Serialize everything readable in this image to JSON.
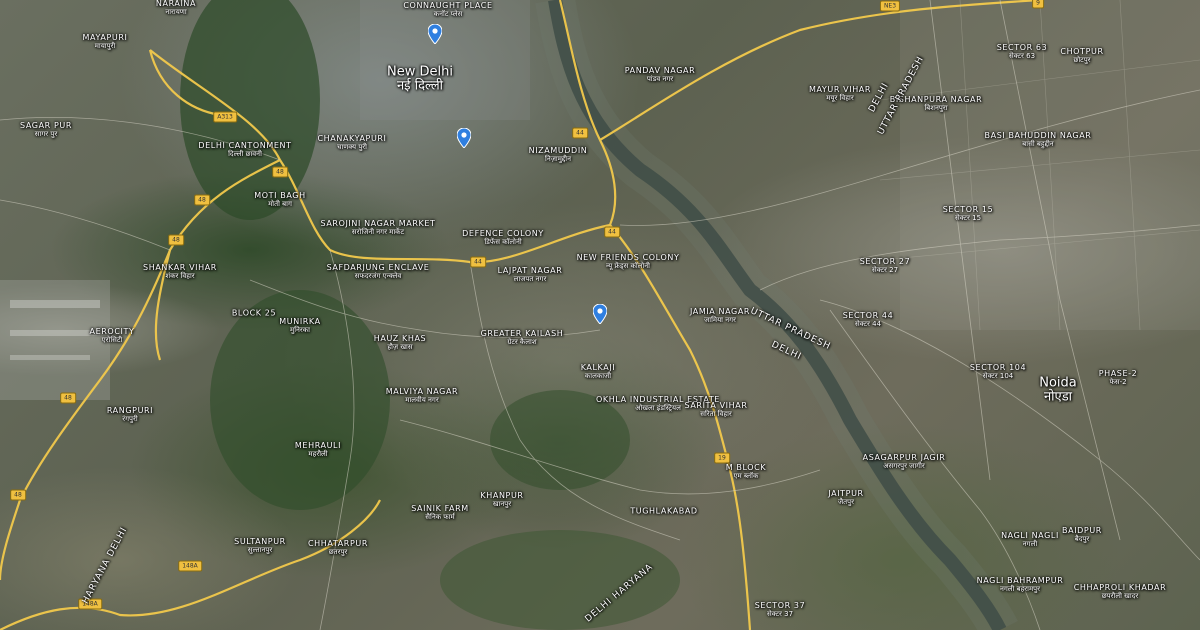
{
  "map": {
    "colors": {
      "road_major": "#f2c94c",
      "river": "#2f3d3a",
      "pin": "#2f7fe0",
      "label": "#ffffff"
    },
    "pins": [
      {
        "name": "pin-1"
      },
      {
        "name": "pin-2"
      },
      {
        "name": "pin-3"
      }
    ],
    "labels": {
      "naraina": {
        "en": "NARAINA",
        "hi": "नारायणा"
      },
      "connaught": {
        "en": "CONNAUGHT PLACE",
        "hi": "कनॉट प्लेस"
      },
      "mayapuri": {
        "en": "MAYAPURI",
        "hi": "मायापुरी"
      },
      "new_delhi": {
        "en": "New Delhi",
        "hi": "नई दिल्ली"
      },
      "sagarpur": {
        "en": "SAGAR PUR",
        "hi": "सागर पुर"
      },
      "chanakyapuri": {
        "en": "CHANAKYAPURI",
        "hi": "चाणक्य पुरी"
      },
      "moti_bagh": {
        "en": "MOTI BAGH",
        "hi": "मोती बाग"
      },
      "sarojini": {
        "en": "SAROJINI NAGAR MARKET",
        "hi": "सरोजिनी नगर मार्केट"
      },
      "defence_colony": {
        "en": "DEFENCE COLONY",
        "hi": "डिफेंस कॉलोनी"
      },
      "nizamuddin": {
        "en": "NIZAMUDDIN",
        "hi": "निज़ामुद्दीन"
      },
      "pandav_nagar": {
        "en": "PANDAV NAGAR",
        "hi": "पांडव नगर"
      },
      "lajpat_nagar": {
        "en": "LAJPAT NAGAR",
        "hi": "लाजपत नगर"
      },
      "safdarjung": {
        "en": "SAFDARJUNG ENCLAVE",
        "hi": "सफदरजंग एन्क्लेव"
      },
      "shankar_vihar": {
        "en": "SHANKAR VIHAR",
        "hi": "शंकर विहार"
      },
      "aerocity": {
        "en": "AEROCITY",
        "hi": "एरोसिटी"
      },
      "hauz_khas": {
        "en": "HAUZ KHAS",
        "hi": "हौज़ खास"
      },
      "greater_kailash": {
        "en": "GREATER KAILASH",
        "hi": "ग्रेटर कैलाश"
      },
      "rangpuri": {
        "en": "RANGPURI",
        "hi": "रंगपुरी"
      },
      "sainik_farm": {
        "en": "SAINIK FARM",
        "hi": "सैनिक फार्म"
      },
      "khanpur": {
        "en": "KHANPUR",
        "hi": "खानपुर"
      },
      "m_block": {
        "en": "M BLOCK",
        "hi": "एम ब्लॉक"
      },
      "jaitpur": {
        "en": "JAITPUR",
        "hi": "जैतपुर"
      },
      "sector_44": {
        "en": "SECTOR 44",
        "hi": "सेक्टर 44"
      },
      "sector_104": {
        "en": "SECTOR 104",
        "hi": "सेक्टर 104"
      },
      "sector_63": {
        "en": "SECTOR 63",
        "hi": "सेक्टर 63"
      },
      "noida": {
        "en": "Noida",
        "hi": "नोएडा"
      },
      "phase_2": {
        "en": "PHASE-2",
        "hi": "फेस-2"
      },
      "bishanpura": {
        "en": "Bishanpura Nagar",
        "hi": "बिशनपुरा"
      },
      "basi": {
        "en": "Basi Bahuddin Nagar",
        "hi": "बासी बहुद्दीन"
      },
      "chotpur": {
        "en": "Chotpur",
        "hi": "छोटपुर"
      },
      "asagarpur": {
        "en": "Asagarpur Jagir",
        "hi": "असगरपुर जागीर"
      },
      "nagli": {
        "en": "Nagli Nagli",
        "hi": "नगली"
      },
      "nagli_bahrampur": {
        "en": "Nagli Bahrampur",
        "hi": "नगली बहरामपुर"
      },
      "chhaproli": {
        "en": "Chhaproli Khadar",
        "hi": "छपरौली खादर"
      },
      "baidpur": {
        "en": "Baidpur",
        "hi": "बैदपुर"
      },
      "sector_37": {
        "en": "SECTOR 37",
        "hi": "सेक्टर 37"
      },
      "new_friends": {
        "en": "NEW FRIENDS COLONY",
        "hi": "न्यू फ्रेंड्स कॉलोनी"
      },
      "malviya_nagar": {
        "en": "MALVIYA NAGAR",
        "hi": "मालवीय नगर"
      },
      "block_25": {
        "en": "BLOCK 25",
        "hi": ""
      },
      "mehrauli": {
        "en": "MEHRAULI",
        "hi": "महरौली"
      },
      "sultanpur": {
        "en": "SULTANPUR",
        "hi": "सुल्तानपुर"
      },
      "chhatarpur": {
        "en": "CHHATARPUR",
        "hi": "छतरपुर"
      },
      "delhi_cantonment": {
        "en": "DELHI CANTONMENT",
        "hi": "दिल्ली छावनी"
      },
      "munirka": {
        "en": "MUNIRKA",
        "hi": "मुनिरका"
      },
      "tughlakabad": {
        "en": "TUGHLAKABAD",
        "hi": "तुगलकाबाद"
      },
      "kalkaji": {
        "en": "KALKAJI",
        "hi": "कालकाजी"
      },
      "sarita_vihar": {
        "en": "SARITA VIHAR",
        "hi": "सरिता विहार"
      },
      "okhla": {
        "en": "OKHLA INDUSTRIAL ESTATE",
        "hi": "ओखला इंडस्ट्रियल"
      },
      "mayur_vihar": {
        "en": "MAYUR VIHAR",
        "hi": "मयूर विहार"
      },
      "jamia": {
        "en": "JAMIA NAGAR",
        "hi": "जामिया नगर"
      },
      "sector_27": {
        "en": "SECTOR 27",
        "hi": "सेक्टर 27"
      },
      "sector_15": {
        "en": "SECTOR 15",
        "hi": "सेक्टर 15"
      }
    },
    "regions": {
      "delhi_1": "DELHI",
      "uttar_pradesh_1": "UTTAR PRADESH",
      "uttar_pradesh_2": "UTTAR PRADESH",
      "delhi_2": "DELHI",
      "haryana_delhi": "HARYANA DELHI",
      "delhi_haryana": "DELHI HARYANA"
    },
    "shields": {
      "nh48_a": "48",
      "nh48_b": "48",
      "nh48_c": "48",
      "nh48_d": "48",
      "nh44_a": "44",
      "nh44_b": "44",
      "nh44_c": "44",
      "nh9": "9",
      "ne3": "NE3",
      "nh19": "19",
      "nh148a_a": "148A",
      "nh148a_b": "148A",
      "a313": "A313"
    }
  }
}
